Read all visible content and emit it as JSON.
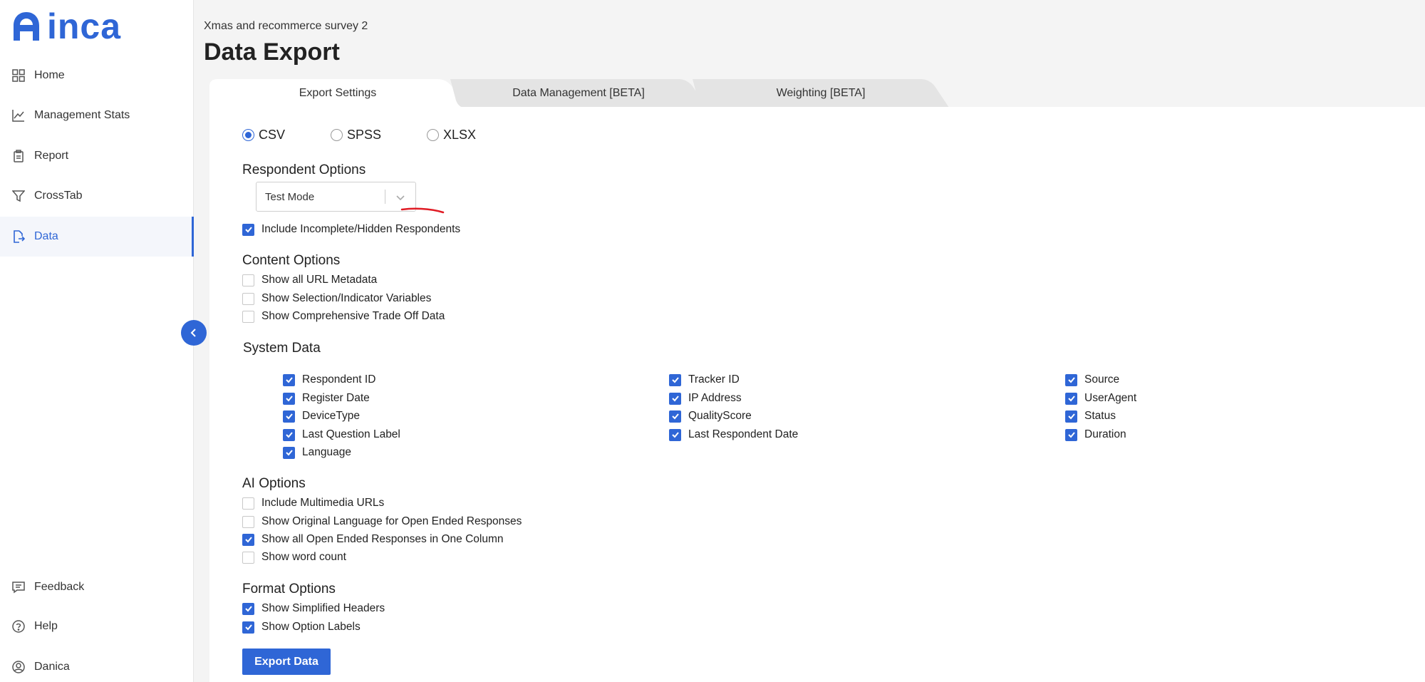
{
  "brand": {
    "name": "inca",
    "color": "#2f66d6"
  },
  "sidebar": {
    "items": [
      {
        "label": "Home",
        "icon": "grid-icon"
      },
      {
        "label": "Management Stats",
        "icon": "line-chart-icon"
      },
      {
        "label": "Report",
        "icon": "clipboard-icon"
      },
      {
        "label": "CrossTab",
        "icon": "filter-icon"
      },
      {
        "label": "Data",
        "icon": "export-file-icon",
        "active": true
      }
    ],
    "bottom": [
      {
        "label": "Feedback",
        "icon": "feedback-icon"
      },
      {
        "label": "Help",
        "icon": "help-icon"
      },
      {
        "label": "Danica",
        "icon": "user-icon"
      }
    ]
  },
  "header": {
    "subtitle": "Xmas and recommerce survey 2",
    "title": "Data Export"
  },
  "tabs": [
    {
      "label": "Export Settings",
      "active": true
    },
    {
      "label": "Data Management [BETA]",
      "active": false
    },
    {
      "label": "Weighting [BETA]",
      "active": false
    }
  ],
  "format": {
    "options": [
      {
        "label": "CSV",
        "selected": true
      },
      {
        "label": "SPSS",
        "selected": false
      },
      {
        "label": "XLSX",
        "selected": false
      }
    ]
  },
  "respondent_options": {
    "title": "Respondent Options",
    "select_value": "Test Mode",
    "include_incomplete": {
      "label": "Include Incomplete/Hidden Respondents",
      "checked": true
    }
  },
  "content_options": {
    "title": "Content Options",
    "items": [
      {
        "label": "Show all URL Metadata",
        "checked": false
      },
      {
        "label": "Show Selection/Indicator Variables",
        "checked": false
      },
      {
        "label": "Show Comprehensive Trade Off Data",
        "checked": false
      }
    ]
  },
  "system_data": {
    "title": "System Data",
    "col1": [
      {
        "label": "Respondent ID",
        "checked": true
      },
      {
        "label": "Register Date",
        "checked": true
      },
      {
        "label": "DeviceType",
        "checked": true
      },
      {
        "label": "Last Question Label",
        "checked": true
      },
      {
        "label": "Language",
        "checked": true
      }
    ],
    "col2": [
      {
        "label": "Tracker ID",
        "checked": true
      },
      {
        "label": "IP Address",
        "checked": true
      },
      {
        "label": "QualityScore",
        "checked": true
      },
      {
        "label": "Last Respondent Date",
        "checked": true
      }
    ],
    "col3": [
      {
        "label": "Source",
        "checked": true
      },
      {
        "label": "UserAgent",
        "checked": true
      },
      {
        "label": "Status",
        "checked": true
      },
      {
        "label": "Duration",
        "checked": true
      }
    ]
  },
  "ai_options": {
    "title": "AI Options",
    "items": [
      {
        "label": "Include Multimedia URLs",
        "checked": false
      },
      {
        "label": "Show Original Language for Open Ended Responses",
        "checked": false
      },
      {
        "label": "Show all Open Ended Responses in One Column",
        "checked": true
      },
      {
        "label": "Show word count",
        "checked": false
      }
    ]
  },
  "format_options": {
    "title": "Format Options",
    "items": [
      {
        "label": "Show Simplified Headers",
        "checked": true
      },
      {
        "label": "Show Option Labels",
        "checked": true
      }
    ]
  },
  "export_button": "Export Data"
}
